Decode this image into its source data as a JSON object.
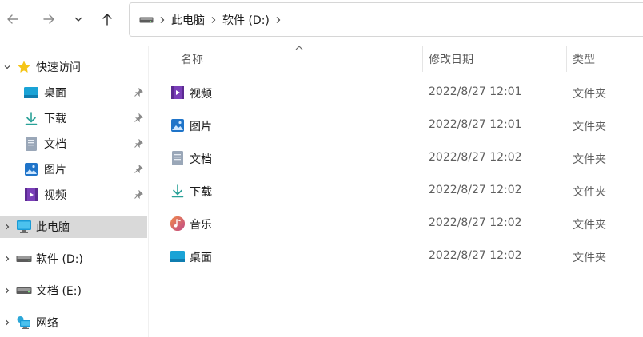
{
  "nav": {
    "back_icon": "back-arrow-icon",
    "forward_icon": "forward-arrow-icon",
    "recent_icon": "chevron-down-icon",
    "up_icon": "up-arrow-icon"
  },
  "address": {
    "root_icon": "drive-icon",
    "crumbs": [
      "此电脑",
      "软件 (D:)"
    ]
  },
  "sidebar": {
    "quick_access": {
      "label": "快速访问",
      "items": [
        {
          "label": "桌面",
          "icon": "desktop-icon"
        },
        {
          "label": "下载",
          "icon": "download-icon"
        },
        {
          "label": "文档",
          "icon": "document-icon"
        },
        {
          "label": "图片",
          "icon": "pictures-icon"
        },
        {
          "label": "视频",
          "icon": "videos-icon"
        }
      ]
    },
    "this_pc": {
      "label": "此电脑",
      "icon": "computer-icon"
    },
    "drives": [
      {
        "label": "软件 (D:)",
        "icon": "drive-icon"
      },
      {
        "label": "文档 (E:)",
        "icon": "drive-icon"
      }
    ],
    "network": {
      "label": "网络",
      "icon": "network-icon"
    }
  },
  "columns": {
    "name": "名称",
    "modified": "修改日期",
    "type": "类型"
  },
  "files": [
    {
      "name": "视频",
      "date": "2022/8/27 12:01",
      "type": "文件夹",
      "icon": "videos-icon"
    },
    {
      "name": "图片",
      "date": "2022/8/27 12:01",
      "type": "文件夹",
      "icon": "pictures-icon"
    },
    {
      "name": "文档",
      "date": "2022/8/27 12:02",
      "type": "文件夹",
      "icon": "document-icon"
    },
    {
      "name": "下载",
      "date": "2022/8/27 12:02",
      "type": "文件夹",
      "icon": "download-icon"
    },
    {
      "name": "音乐",
      "date": "2022/8/27 12:02",
      "type": "文件夹",
      "icon": "music-icon"
    },
    {
      "name": "桌面",
      "date": "2022/8/27 12:02",
      "type": "文件夹",
      "icon": "desktop-icon"
    }
  ],
  "colors": {
    "selected_bg": "#d9d9d9",
    "header_text": "#5a5a5a",
    "accent_star": "#f5c518"
  }
}
